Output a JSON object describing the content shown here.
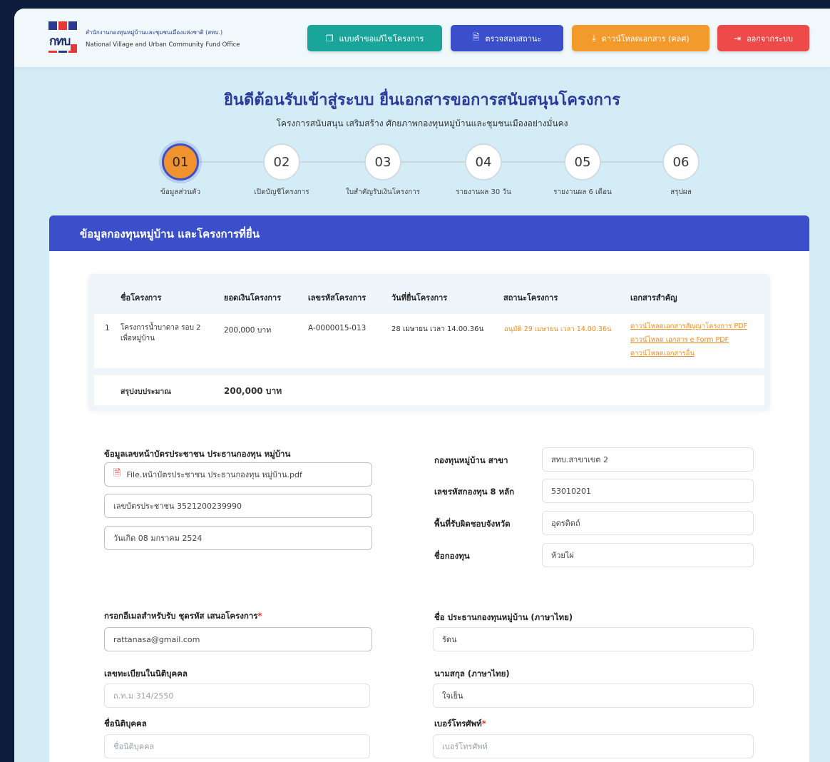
{
  "header": {
    "logo_mark": "กทบ",
    "org_name_th": "สำนักงานกองทุนหมู่บ้านและชุมชนเมืองแห่งชาติ (สทบ.)",
    "org_name_en": "National Village and Urban Community Fund Office",
    "buttons": [
      {
        "label": "แบบคำขอแก้ไขโครงการ",
        "icon": "document-copy-icon",
        "color": "#1aa59b"
      },
      {
        "label": "ตรวจสอบสถานะ",
        "icon": "file-icon",
        "color": "#3a4fc9"
      },
      {
        "label": "ดาวน์โหลดเอกสาร (คลศ)",
        "icon": "download-icon",
        "color": "#f39a2d"
      },
      {
        "label": "ออกจากระบบ",
        "icon": "logout-icon",
        "color": "#ee4a4a"
      }
    ]
  },
  "page": {
    "title": "ยินดีต้อนรับเข้าสู่ระบบ ยื่นเอกสารขอการสนับสนุนโครงการ",
    "subtitle": "โครงการสนับสนุน เสริมสร้าง ศักยภาพกองทุนหมู่บ้านและชุมชนเมืองอย่างมั่นคง"
  },
  "steps": [
    {
      "num": "01",
      "label": "ข้อมูลส่วนตัว",
      "active": true
    },
    {
      "num": "02",
      "label": "เปิดบัญชีโครงการ",
      "active": false
    },
    {
      "num": "03",
      "label": "ใบสำคัญรับเงินโครงการ",
      "active": false
    },
    {
      "num": "04",
      "label": "รายงานผล 30 วัน",
      "active": false
    },
    {
      "num": "05",
      "label": "รายงานผล 6 เดือน",
      "active": false
    },
    {
      "num": "06",
      "label": "สรุปผล",
      "active": false
    }
  ],
  "panel": {
    "title": "ข้อมูลกองทุนหมู่บ้าน และโครงการที่ยื่น"
  },
  "table": {
    "headers": [
      "ชื่อโครงการ",
      "ยอดเงินโครงการ",
      "เลขรหัสโครงการ",
      "วันที่ยื่นโครงการ",
      "สถานะโครงการ",
      "เอกสารสำคัญ"
    ],
    "row": {
      "index": "1",
      "name": "โครงการน้ำบาดาล รอบ 2 เพื่อหมู่บ้าน",
      "amount": "200,000 บาท",
      "code": "A-0000015-013",
      "date": "28 เมษายน เวลา 14.00.36น",
      "status": "อนุมัติ 29 เมษายน เวลา 14.00.36น",
      "docs": [
        "ดาวน์โหลดเอกสารสัญญาโครงการ PDF",
        "ดาวน์โหลด เอกสาร e Form PDF",
        "ดาวน์โหลดเอกสารอื่น"
      ]
    },
    "summary_label": "สรุปงบประมาณ",
    "summary_value": "200,000 บาท"
  },
  "form": {
    "id_card_label": "ข้อมูลเลขหน้าบัตรประชาชน ประธานกองทุน หมู่บ้าน",
    "id_card_file": "File.หน้าบัตรประชาชน ประธานกองทุน หมู่บ้าน.pdf",
    "id_number": "เลขบัตรประชาชน 3521200239990",
    "birth_date": "วันเกิด 08 มกราคม 2524",
    "branch_label": "กองทุนหมู่บ้าน สาขา",
    "branch_value": "สทบ.สาขาเขต 2",
    "fund_code_label": "เลขรหัสกองทุน 8 หลัก",
    "fund_code_value": "53010201",
    "province_label": "พื้นที่รับผิดชอบจังหวัด",
    "province_value": "อุตรดิตถ์",
    "fund_name_label": "ชื่อกองทุน",
    "fund_name_value": "ห้วยไผ่",
    "email_label": "กรอกอีเมลสำหรับรับ ชุดรหัส เสนอโครงการ",
    "email_value": "rattanasa@gmail.com",
    "chair_name_label": "ชื่อ ประธานกองทุนหมู่บ้าน (ภาษาไทย)",
    "chair_name_value": "รัตน",
    "reg_label": "เลขทะเบียนในนิติบุคคล",
    "reg_placeholder": "ถ.ท.ม 314/2550",
    "surname_label": "นามสกุล (ภาษาไทย)",
    "surname_value": "ใจเย็น",
    "entity_label": "ชื่อนิติบุคคล",
    "entity_placeholder": "ชื่อนิติบุคคล",
    "phone_label": "เบอร์โทรศัพท์",
    "phone_placeholder": "เบอร์โทรศัพท์",
    "required_mark": "*"
  }
}
